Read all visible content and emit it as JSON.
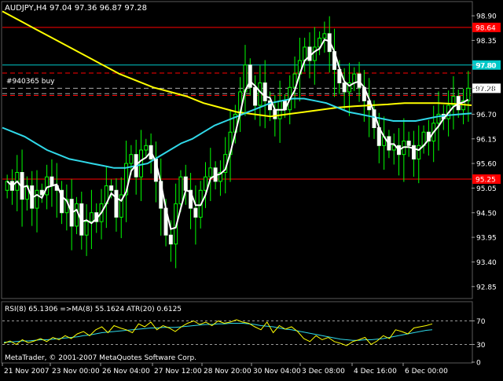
{
  "chart_data": {
    "type": "candlestick",
    "header": "AUDJPY,H4  97.04 97.36 96.87 97.28",
    "order_label": "#940365 buy",
    "copyright": "MetaTrader, © 2001-2007 MetaQuotes Software Corp.",
    "price_axis": {
      "ylim": [
        92.6,
        99.2
      ],
      "ticks": [
        "98.90",
        "98.35",
        "97.80",
        "97.28",
        "96.70",
        "96.15",
        "95.60",
        "95.05",
        "94.50",
        "93.95",
        "93.40",
        "92.85"
      ]
    },
    "price_lines": [
      {
        "value": 98.64,
        "label": "98.64",
        "color": "#ff0000"
      },
      {
        "value": 97.8,
        "label": "97.80",
        "color": "#00c8c8"
      },
      {
        "value": 95.25,
        "label": "95.25",
        "color": "#ff0000"
      }
    ],
    "last_price": {
      "value": 97.28,
      "label": "97.28"
    },
    "dashed_lines": [
      {
        "value": 97.62,
        "color": "#ff0000"
      },
      {
        "value": 97.28,
        "color": "#aaaaaa"
      },
      {
        "value": 97.16,
        "color": "#aaaaaa"
      },
      {
        "value": 97.12,
        "color": "#ff0000"
      }
    ],
    "x_labels": [
      "21 Nov 2007",
      "23 Nov 00:00",
      "26 Nov 04:00",
      "27 Nov 12:00",
      "28 Nov 20:00",
      "30 Nov 04:00",
      "3 Dec 08:00",
      "4 Dec 16:00",
      "6 Dec 00:00"
    ],
    "closes": [
      95.2,
      95.0,
      95.4,
      94.8,
      95.1,
      94.6,
      95.0,
      94.9,
      95.3,
      95.1,
      95.0,
      94.5,
      94.8,
      94.2,
      94.7,
      94.0,
      94.3,
      94.5,
      94.3,
      94.7,
      95.1,
      95.0,
      94.4,
      94.9,
      95.6,
      95.8,
      95.3,
      95.9,
      96.0,
      95.7,
      95.2,
      94.6,
      94.0,
      93.8,
      94.7,
      95.3,
      95.0,
      94.6,
      94.4,
      95.0,
      95.3,
      95.5,
      95.2,
      95.4,
      95.8,
      96.3,
      96.7,
      97.2,
      97.8,
      97.3,
      96.9,
      97.4,
      97.0,
      96.8,
      96.6,
      97.0,
      96.8,
      97.3,
      97.6,
      97.9,
      98.2,
      97.9,
      98.2,
      98.4,
      98.5,
      98.1,
      97.7,
      97.4,
      97.2,
      97.4,
      97.6,
      97.3,
      97.0,
      96.8,
      96.4,
      96.0,
      96.2,
      95.9,
      96.0,
      95.8,
      96.1,
      96.0,
      95.7,
      96.0,
      96.3,
      96.1,
      96.5,
      96.7,
      96.6,
      96.9,
      97.1,
      96.8,
      97.0,
      97.28
    ],
    "series": [
      {
        "values": [
          99.0,
          98.8,
          98.6,
          98.4,
          98.2,
          98.0,
          97.8,
          97.6,
          97.45,
          97.3,
          97.2,
          97.1,
          96.95,
          96.85,
          96.75,
          96.7,
          96.65,
          96.7,
          96.75,
          96.8,
          96.85,
          96.88,
          96.9,
          96.92,
          96.95,
          96.95,
          96.95,
          96.93,
          96.9
        ],
        "color": "#ffff00"
      },
      {
        "values": [
          96.4,
          96.3,
          96.2,
          96.05,
          95.9,
          95.8,
          95.7,
          95.65,
          95.6,
          95.55,
          95.5,
          95.5,
          95.55,
          95.6,
          95.75,
          95.9,
          96.05,
          96.15,
          96.3,
          96.45,
          96.55,
          96.65,
          96.75,
          96.85,
          96.95,
          97.0,
          97.05,
          97.05,
          97.0,
          96.95,
          96.85,
          96.75,
          96.7,
          96.65,
          96.6,
          96.55,
          96.55,
          96.55,
          96.6,
          96.65,
          96.68,
          96.7,
          96.72
        ],
        "color": "#30d8e8"
      }
    ],
    "rsi_header": "RSI(8) 65.1306   =>MA(8) 55.1624   ATR(20) 0.6125",
    "rsi_axis": {
      "ylim": [
        0,
        100
      ],
      "ticks": [
        "70",
        "30",
        "0"
      ],
      "levels": [
        70,
        30
      ]
    },
    "rsi": [
      32,
      36,
      30,
      38,
      33,
      36,
      40,
      35,
      42,
      38,
      45,
      40,
      48,
      52,
      45,
      55,
      60,
      50,
      62,
      58,
      55,
      50,
      65,
      60,
      68,
      55,
      62,
      58,
      52,
      60,
      66,
      70,
      64,
      68,
      62,
      70,
      66,
      68,
      72,
      68,
      66,
      60,
      55,
      68,
      50,
      62,
      56,
      60,
      52,
      40,
      35,
      45,
      38,
      42,
      35,
      32,
      28,
      35,
      38,
      42,
      30,
      36,
      45,
      40,
      55,
      52,
      48,
      58,
      60,
      62,
      65
    ],
    "rsi_ma": [
      34,
      34,
      35,
      36,
      36,
      37,
      38,
      38,
      39,
      40,
      41,
      42,
      43,
      45,
      46,
      48,
      50,
      51,
      52,
      53,
      54,
      55,
      56,
      57,
      58,
      58,
      59,
      59,
      59,
      60,
      61,
      62,
      63,
      64,
      64,
      65,
      65,
      66,
      66,
      66,
      65,
      64,
      62,
      61,
      60,
      58,
      56,
      55,
      53,
      51,
      49,
      47,
      45,
      43,
      41,
      39,
      38,
      37,
      37,
      38,
      38,
      39,
      40,
      42,
      44,
      46,
      48,
      50,
      52,
      54,
      55
    ]
  }
}
